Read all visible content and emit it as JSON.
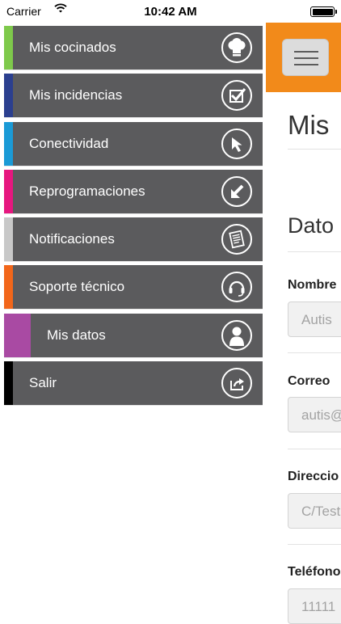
{
  "status_bar": {
    "carrier": "Carrier",
    "time": "10:42 AM"
  },
  "menu": {
    "items": [
      {
        "label": "Mis cocinados",
        "accent": "#7ec94b"
      },
      {
        "label": "Mis incidencias",
        "accent": "#2b3f8f"
      },
      {
        "label": "Conectividad",
        "accent": "#1a9ad6"
      },
      {
        "label": "Reprogramaciones",
        "accent": "#e6177f"
      },
      {
        "label": "Notificaciones",
        "accent": "#c8c8c8"
      },
      {
        "label": "Soporte técnico",
        "accent": "#f2661a"
      },
      {
        "label": "Mis datos",
        "accent": "#a94aa3",
        "selected": true
      },
      {
        "label": "Salir",
        "accent": "#000000"
      }
    ]
  },
  "main": {
    "title": "Mis",
    "section": "Dato",
    "fields": [
      {
        "label": "Nombre",
        "value": "Autis"
      },
      {
        "label": "Correo",
        "value": "autis@"
      },
      {
        "label": "Direccio",
        "value": "C/Test"
      },
      {
        "label": "Teléfono",
        "value": "11111"
      }
    ]
  },
  "colors": {
    "topbar": "#f28a1a",
    "menu_bg": "#5b5b5d"
  }
}
